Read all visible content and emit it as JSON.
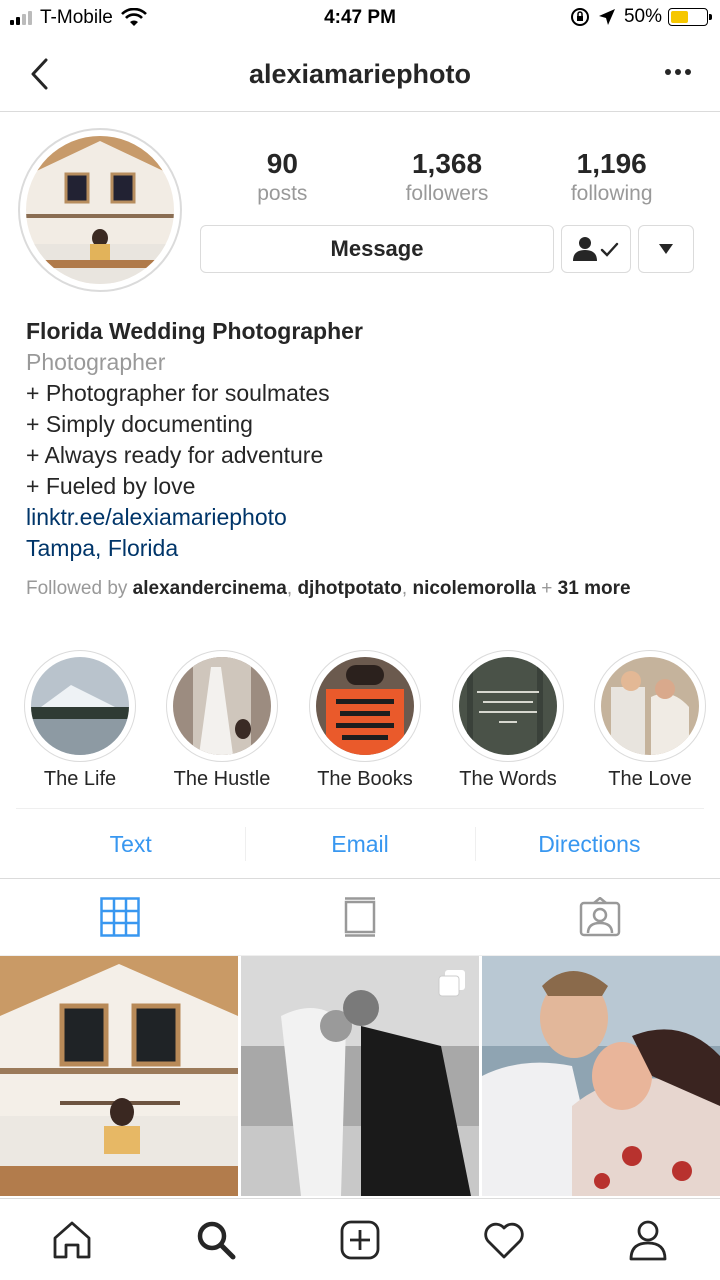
{
  "status_bar": {
    "carrier": "T-Mobile",
    "time": "4:47 PM",
    "battery": "50%"
  },
  "nav": {
    "title": "alexiamariephoto"
  },
  "stats": [
    {
      "value": "90",
      "label": "posts"
    },
    {
      "value": "1,368",
      "label": "followers"
    },
    {
      "value": "1,196",
      "label": "following"
    }
  ],
  "actions": {
    "message_label": "Message"
  },
  "bio": {
    "name": "Florida Wedding Photographer",
    "category": "Photographer",
    "lines": [
      "+ Photographer for soulmates",
      "+ Simply documenting",
      "+ Always ready for adventure",
      "+ Fueled by love"
    ],
    "link": "linktr.ee/alexiamariephoto",
    "location": "Tampa, Florida"
  },
  "followed_by": {
    "prefix": "Followed by ",
    "users": [
      "alexandercinema",
      "djhotpotato",
      "nicolemorolla"
    ],
    "separator": ", ",
    "plus": " + ",
    "more": "31 more"
  },
  "highlights": [
    {
      "label": "The Life"
    },
    {
      "label": "The Hustle"
    },
    {
      "label": "The Books"
    },
    {
      "label": "The Words"
    },
    {
      "label": "The Love"
    }
  ],
  "contact": {
    "text": "Text",
    "email": "Email",
    "directions": "Directions"
  },
  "colors": {
    "link": "#003569",
    "accent": "#3897f0",
    "border": "#dbdbdb",
    "secondary": "#999999"
  }
}
